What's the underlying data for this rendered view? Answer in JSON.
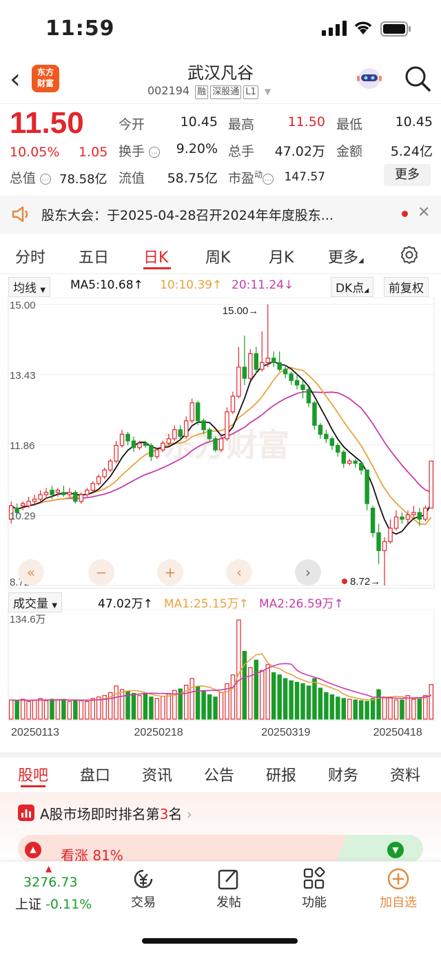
{
  "status_bar": {
    "time": "11:59"
  },
  "header": {
    "logo_line1": "东方",
    "logo_line2": "财富",
    "stock_name": "武汉凡谷",
    "stock_code": "002194",
    "tags": [
      "融",
      "深股通",
      "L1"
    ]
  },
  "quote": {
    "price": "11.50",
    "change_pct": "10.05%",
    "change_abs": "1.05",
    "open_label": "今开",
    "open": "10.45",
    "high_label": "最高",
    "high": "11.50",
    "low_label": "最低",
    "low": "10.45",
    "turnover_label": "换手",
    "turnover": "9.20%",
    "volume_label": "总手",
    "volume": "47.02万",
    "amount_label": "金额",
    "amount": "5.24亿",
    "mktcap_label": "总值",
    "mktcap": "78.58亿",
    "float_label": "流值",
    "float_val": "58.75亿",
    "pe_label": "市盈",
    "pe_sup": "动",
    "pe": "147.57",
    "more_label": "更多"
  },
  "notice": {
    "text": "股东大会：于2025-04-28召开2024年年度股东..."
  },
  "tabs": {
    "items": [
      "分时",
      "五日",
      "日K",
      "周K",
      "月K",
      "更多"
    ],
    "active": "日K"
  },
  "ma_bar": {
    "selector": "均线",
    "ma5": "MA5:10.68↑",
    "ma10": "10:10.39↑",
    "ma20": "20:11.24↓",
    "dk": "DK点",
    "adj": "前复权"
  },
  "chart_data": [
    {
      "type": "candlestick",
      "title": "",
      "y_ticks": [
        "15.00",
        "13.43",
        "11.86",
        "10.29",
        "8.72"
      ],
      "ylim": [
        8.72,
        15.0
      ],
      "high_marker": "15.00→",
      "low_marker": "8.72→",
      "series_colors": {
        "up": "#e1262b",
        "down": "#1a9b2a",
        "ma5": "#111111",
        "ma10": "#e8a33c",
        "ma20": "#c53dac"
      },
      "candles": [
        [
          10.2,
          10.5,
          10.1,
          10.6
        ],
        [
          10.45,
          10.35,
          10.3,
          10.55
        ],
        [
          10.5,
          10.55,
          10.4,
          10.6
        ],
        [
          10.5,
          10.6,
          10.45,
          10.7
        ],
        [
          10.6,
          10.65,
          10.5,
          10.75
        ],
        [
          10.65,
          10.75,
          10.55,
          10.85
        ],
        [
          10.75,
          10.8,
          10.65,
          10.9
        ],
        [
          10.85,
          10.75,
          10.65,
          10.95
        ],
        [
          10.8,
          10.85,
          10.7,
          10.9
        ],
        [
          10.8,
          10.75,
          10.7,
          10.95
        ],
        [
          10.75,
          10.8,
          10.7,
          10.9
        ],
        [
          10.8,
          10.6,
          10.55,
          10.85
        ],
        [
          10.6,
          10.75,
          10.55,
          10.8
        ],
        [
          10.75,
          10.85,
          10.7,
          10.9
        ],
        [
          10.85,
          11.0,
          10.8,
          11.05
        ],
        [
          11.0,
          11.15,
          10.95,
          11.2
        ],
        [
          11.15,
          11.3,
          11.1,
          11.35
        ],
        [
          11.3,
          11.5,
          11.25,
          11.55
        ],
        [
          11.5,
          11.85,
          11.45,
          11.95
        ],
        [
          11.85,
          12.1,
          11.8,
          12.2
        ],
        [
          12.1,
          11.95,
          11.85,
          12.15
        ],
        [
          11.95,
          11.8,
          11.7,
          12.05
        ],
        [
          11.8,
          11.9,
          11.75,
          11.95
        ],
        [
          11.9,
          11.85,
          11.8,
          11.95
        ],
        [
          11.85,
          11.6,
          11.5,
          11.9
        ],
        [
          11.6,
          11.75,
          11.55,
          11.8
        ],
        [
          11.75,
          11.9,
          11.7,
          11.95
        ],
        [
          11.9,
          12.0,
          11.85,
          12.1
        ],
        [
          12.0,
          12.2,
          11.95,
          12.3
        ],
        [
          12.2,
          12.05,
          11.95,
          12.3
        ],
        [
          12.05,
          12.4,
          12.0,
          12.5
        ],
        [
          12.4,
          12.8,
          12.35,
          12.9
        ],
        [
          12.8,
          12.4,
          12.3,
          12.85
        ],
        [
          12.4,
          12.2,
          12.1,
          12.45
        ],
        [
          12.2,
          12.0,
          11.95,
          12.25
        ],
        [
          12.0,
          11.75,
          11.7,
          12.05
        ],
        [
          11.75,
          12.0,
          11.7,
          12.1
        ],
        [
          12.0,
          12.6,
          11.95,
          12.7
        ],
        [
          12.6,
          12.95,
          12.55,
          13.05
        ],
        [
          12.95,
          13.6,
          12.9,
          14.05
        ],
        [
          13.6,
          13.35,
          13.2,
          14.3
        ],
        [
          13.35,
          13.9,
          13.3,
          14.0
        ],
        [
          13.9,
          13.55,
          13.45,
          14.05
        ],
        [
          13.55,
          13.7,
          13.5,
          14.4
        ],
        [
          13.7,
          13.8,
          13.6,
          15.0
        ],
        [
          13.8,
          13.7,
          13.6,
          13.95
        ],
        [
          13.7,
          13.55,
          13.5,
          13.95
        ],
        [
          13.55,
          13.45,
          13.35,
          13.65
        ],
        [
          13.45,
          13.3,
          13.2,
          13.5
        ],
        [
          13.3,
          13.2,
          13.1,
          13.45
        ],
        [
          13.2,
          13.1,
          12.9,
          13.3
        ],
        [
          13.1,
          12.8,
          12.7,
          13.15
        ],
        [
          12.8,
          12.3,
          12.2,
          12.85
        ],
        [
          12.3,
          12.1,
          12.0,
          12.35
        ],
        [
          12.1,
          12.0,
          11.9,
          12.2
        ],
        [
          12.0,
          11.85,
          11.75,
          12.05
        ],
        [
          11.85,
          11.7,
          11.6,
          11.9
        ],
        [
          11.7,
          11.45,
          11.35,
          11.75
        ],
        [
          11.45,
          11.5,
          11.4,
          11.55
        ],
        [
          11.5,
          11.45,
          11.35,
          11.55
        ],
        [
          11.45,
          11.3,
          11.2,
          11.5
        ],
        [
          11.3,
          10.55,
          10.4,
          11.3
        ],
        [
          10.45,
          9.9,
          9.8,
          10.5
        ],
        [
          9.9,
          9.5,
          9.2,
          10.1
        ],
        [
          9.5,
          9.7,
          8.72,
          9.8
        ],
        [
          9.7,
          10.0,
          9.65,
          10.2
        ],
        [
          10.0,
          10.25,
          9.95,
          10.4
        ],
        [
          10.25,
          10.2,
          10.1,
          10.35
        ],
        [
          10.2,
          10.3,
          10.1,
          10.4
        ],
        [
          10.3,
          10.35,
          10.25,
          10.5
        ],
        [
          10.35,
          10.2,
          10.05,
          10.45
        ],
        [
          10.2,
          10.45,
          10.15,
          10.5
        ],
        [
          10.45,
          11.5,
          10.45,
          11.5
        ]
      ]
    },
    {
      "type": "bar",
      "title": "",
      "selector": "成交量",
      "value_label": "47.02万↑",
      "ma1_label": "MA1:25.15万↑",
      "ma2_label": "MA2:26.59万↑",
      "y_top_label": "134.6万",
      "dates": [
        "20250113",
        "20250218",
        "20250319",
        "20250418"
      ],
      "values": [
        26,
        25,
        27,
        24,
        26,
        28,
        25,
        27,
        26,
        27,
        24,
        26,
        25,
        24,
        28,
        30,
        32,
        36,
        45,
        40,
        38,
        35,
        32,
        34,
        30,
        28,
        31,
        34,
        39,
        41,
        46,
        55,
        44,
        38,
        33,
        30,
        36,
        48,
        60,
        134.6,
        92,
        70,
        80,
        66,
        74,
        63,
        60,
        55,
        52,
        50,
        48,
        45,
        55,
        42,
        36,
        33,
        30,
        28,
        27,
        26,
        25,
        24,
        28,
        40,
        30,
        30,
        26,
        26,
        32,
        27,
        29,
        32,
        47
      ]
    }
  ],
  "chart_buttons": [
    "«",
    "−",
    "+",
    "‹",
    "›"
  ],
  "bottom_tabs": {
    "items": [
      "股吧",
      "盘口",
      "资讯",
      "公告",
      "研报",
      "财务",
      "资料"
    ],
    "active": "股吧"
  },
  "rank": {
    "prefix": "A股市场即时排名第",
    "rank": "3",
    "suffix": "名",
    "bullish": "看涨 81%"
  },
  "bottom_nav": {
    "index_value": "3276.73",
    "index_name": "上证",
    "index_change": "-0.11%",
    "trade": "交易",
    "post": "发帖",
    "features": "功能",
    "watchlist": "加自选"
  }
}
